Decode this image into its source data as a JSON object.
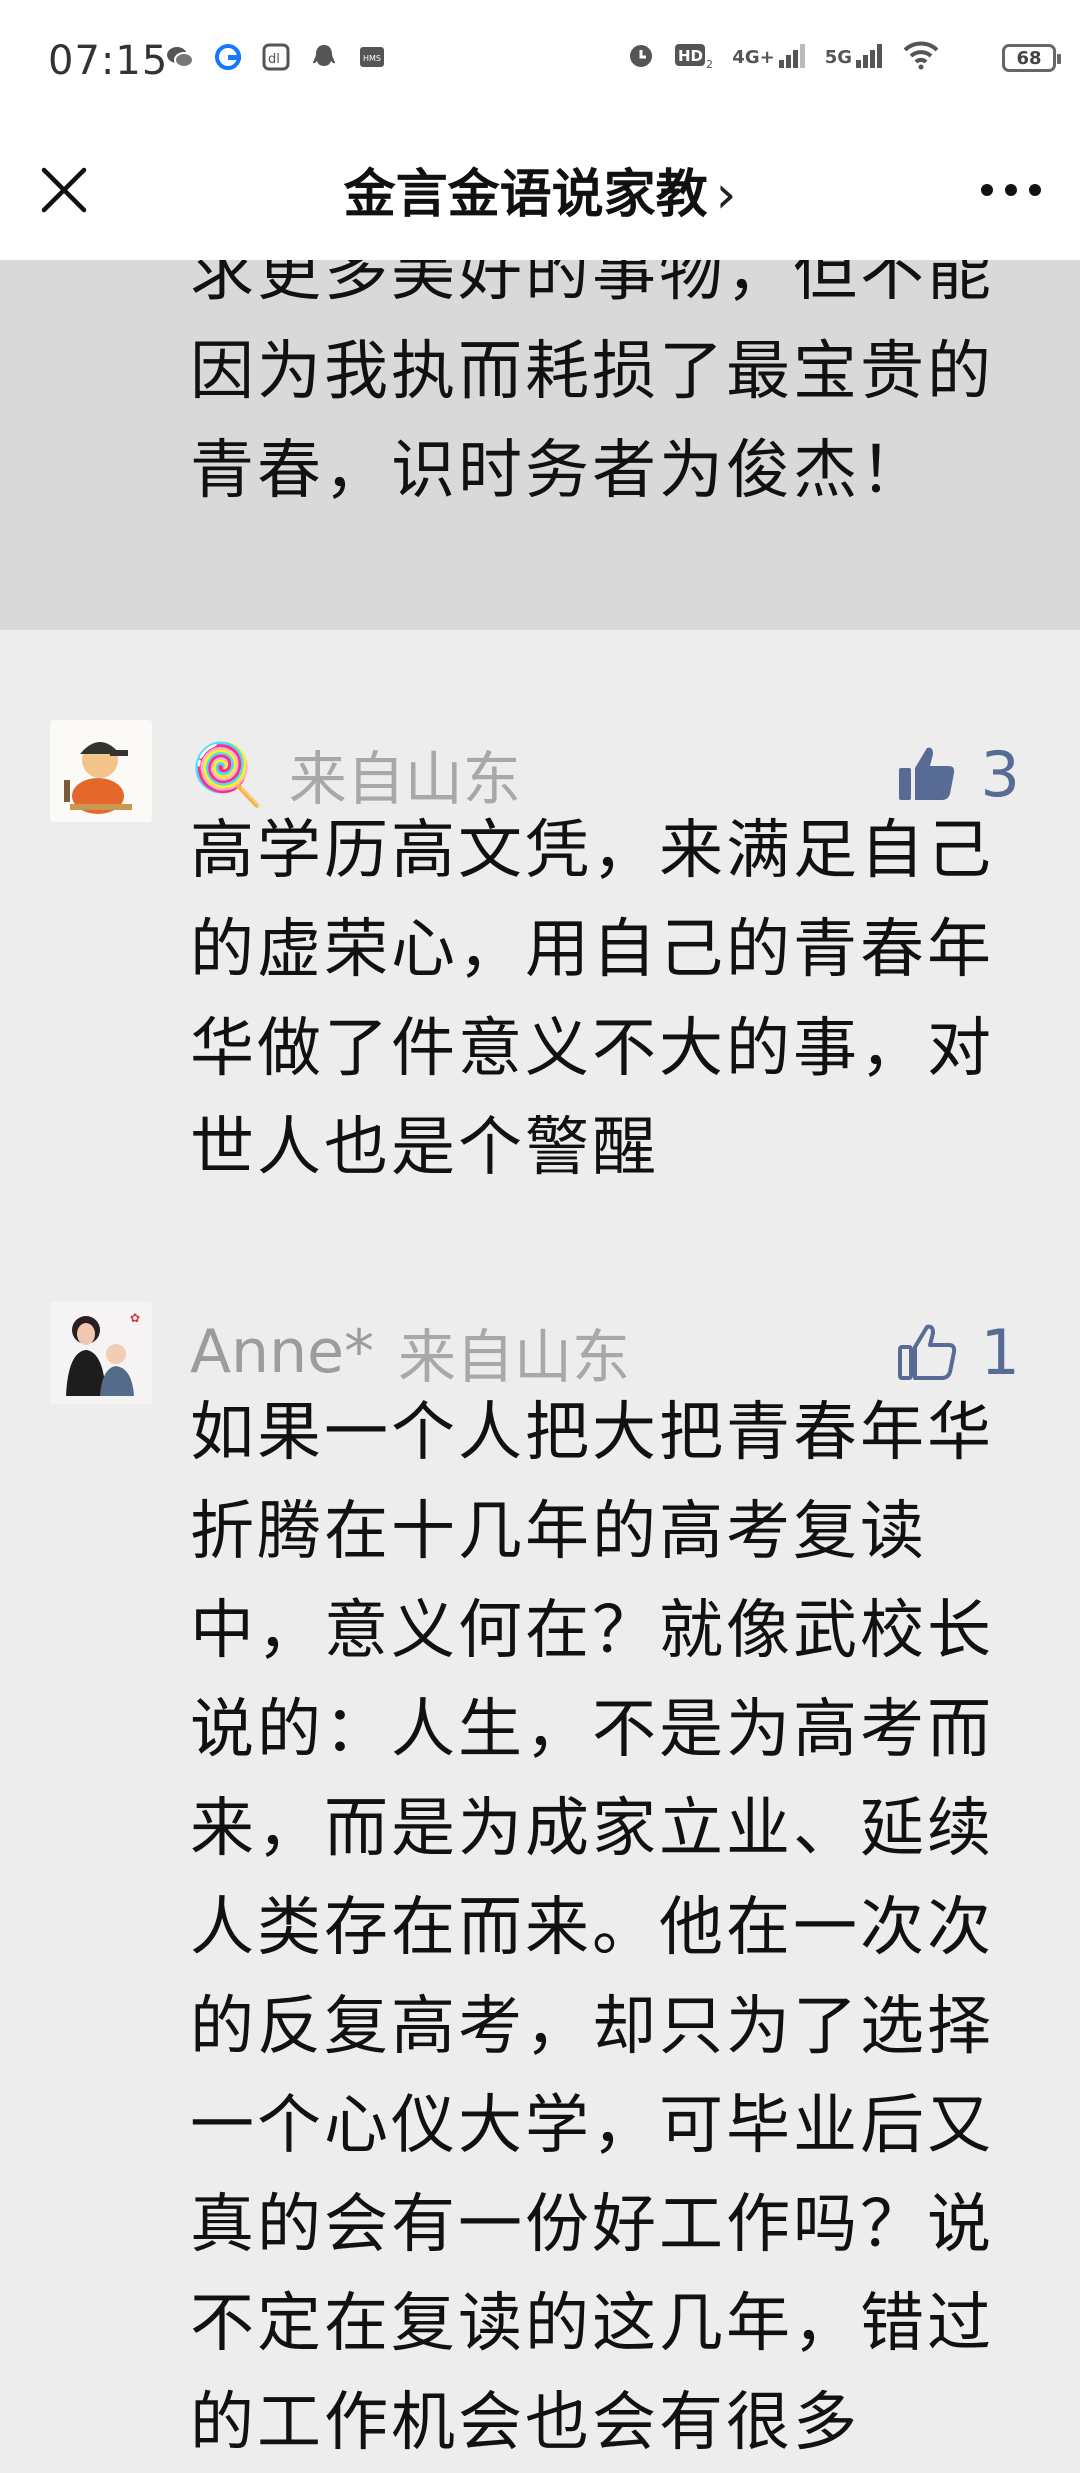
{
  "status_bar": {
    "time": "07:15",
    "network_4g": "4G+",
    "network_5g": "5G",
    "battery": "68"
  },
  "nav": {
    "title": "金言金语说家教",
    "chevron": "›"
  },
  "highlighted_comment": {
    "text": "求更多美好的事物，但不能因为我执而耗损了最宝贵的青春，识时务者为俊杰！"
  },
  "comments": [
    {
      "name": "🍭",
      "location": "来自山东",
      "likes": "3",
      "liked": true,
      "text": "高学历高文凭，来满足自己的虚荣心，用自己的青春年华做了件意义不大的事，对世人也是个警醒"
    },
    {
      "name": "Anne*",
      "location": "来自山东",
      "likes": "1",
      "liked": false,
      "text": "如果一个人把大把青春年华折腾在十几年的高考复读中，意义何在？就像武校长说的：人生，不是为高考而来，而是为成家立业、延续人类存在而来。他在一次次的反复高考，却只为了选择一个心仪大学，可毕业后又真的会有一份好工作吗？说不定在复读的这几年，错过的工作机会也会有很多"
    }
  ],
  "colors": {
    "like_blue": "#576b95",
    "highlight_bg": "#d9d9d9",
    "page_bg": "#ededed"
  }
}
